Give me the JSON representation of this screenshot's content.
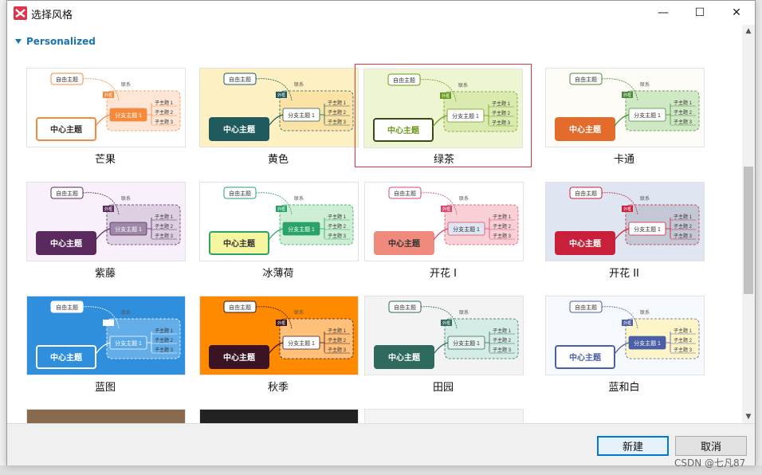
{
  "window": {
    "title": "选择风格",
    "minimize_glyph": "—",
    "maximize_glyph": "☐",
    "close_glyph": "✕"
  },
  "section": {
    "title": "Personalized"
  },
  "styles": [
    {
      "label": "芒果"
    },
    {
      "label": "黄色"
    },
    {
      "label": "绿茶"
    },
    {
      "label": "卡通"
    },
    {
      "label": "紫藤"
    },
    {
      "label": "冰薄荷"
    },
    {
      "label": "开花 I"
    },
    {
      "label": "开花 II"
    },
    {
      "label": "蓝图"
    },
    {
      "label": "秋季"
    },
    {
      "label": "田园"
    },
    {
      "label": "蓝和白"
    }
  ],
  "thumb_text": {
    "center": "中心主题",
    "free": "自由主题",
    "branch": "分支主题 1",
    "sub1": "子主题 1",
    "sub2": "子主题 2",
    "sub3": "子主题 3",
    "link": "联系",
    "outer": "外框"
  },
  "buttons": {
    "ok": "新建",
    "cancel": "取消"
  },
  "watermark": "CSDN @七凡87",
  "selected_index": 2,
  "colors": {
    "accent": "#1a73b6",
    "selection": "#d9363e",
    "primary_border": "#0078d7"
  }
}
